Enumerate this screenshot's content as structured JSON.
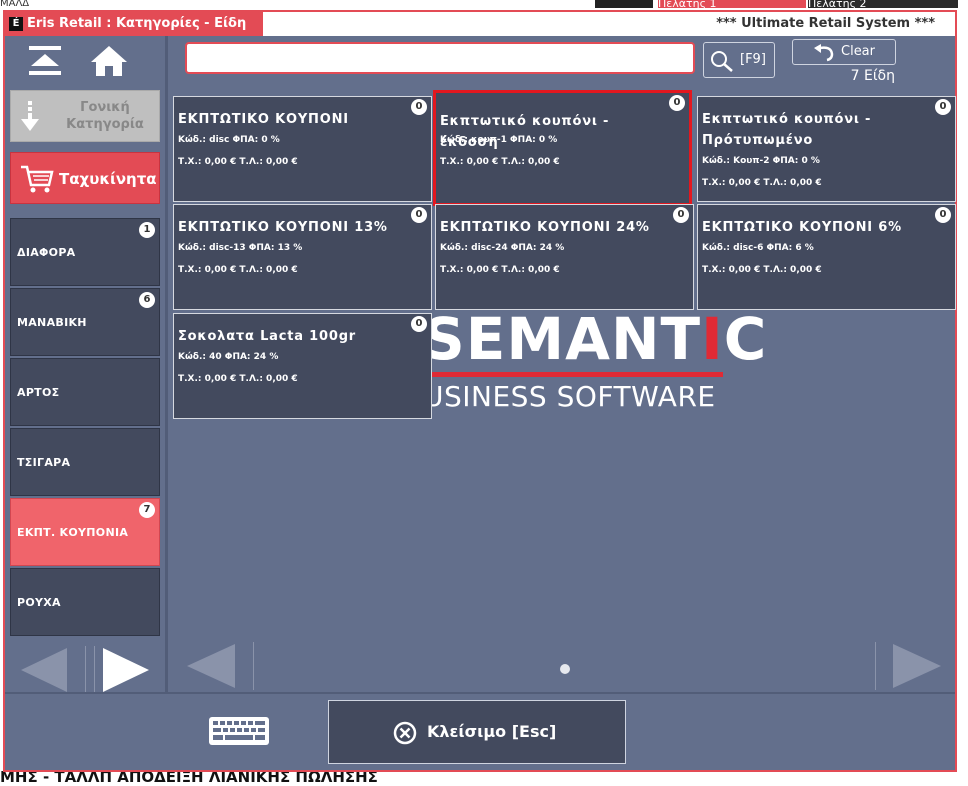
{
  "background": {
    "left_fragment": "ΜΑΛΔ",
    "tab_1": "Πελάτης 1",
    "tab_2": "Πελάτης 2",
    "bottom_text": "ΜΗΣ - ΤΑΛΛΠ ΑΠΟΔΕΙΞΗ ΛΙΑΝΙΚΗΣ ΠΩΛΗΣΗΣ"
  },
  "window": {
    "title": "Eris Retail : Κατηγορίες - Είδη",
    "system_name": "*** Ultimate Retail System ***",
    "app_icon": "É"
  },
  "sidebar": {
    "parent_category_label": "Γονική Κατηγορία",
    "fast_moving_label": "Ταχυκίνητα",
    "categories": [
      {
        "name": "ΔΙΑΦΟΡΑ",
        "count": "1"
      },
      {
        "name": "ΜΑΝΑΒΙΚΗ",
        "count": "6"
      },
      {
        "name": "ΑΡΤΟΣ",
        "count": ""
      },
      {
        "name": "ΤΣΙΓΑΡΑ",
        "count": ""
      },
      {
        "name": "ΕΚΠΤ. ΚΟΥΠΟΝΙΑ",
        "count": "7"
      },
      {
        "name": "ΡΟΥΧΑ",
        "count": ""
      }
    ]
  },
  "search": {
    "value": "",
    "placeholder": "",
    "button_label": "[F9]",
    "clear_label": "Clear",
    "item_count": "7 Είδη"
  },
  "logo": {
    "main_before": "SEMANT",
    "main_red": "I",
    "main_after": "C",
    "subtitle": "USINESS SOFTWARE"
  },
  "products": [
    {
      "name": "ΕΚΠΤΩΤΙΚΟ ΚΟΥΠΟΝΙ",
      "info1": "Κώδ.: disc  ΦΠΑ: 0 %",
      "info2": "Τ.Χ.: 0,00 €  Τ.Λ.: 0,00 €",
      "badge": "0"
    },
    {
      "name": "Εκπτωτικό κουπόνι - έκδοση",
      "info1": "Κώδ.: κουπ-1  ΦΠΑ: 0 %",
      "info2": "Τ.Χ.: 0,00 €  Τ.Λ.: 0,00 €",
      "badge": "0"
    },
    {
      "name": "Εκπτωτικό κουπόνι - Πρότυπωμένο",
      "info1": "Κώδ.: Κουπ-2  ΦΠΑ: 0 %",
      "info2": "Τ.Χ.: 0,00 €  Τ.Λ.: 0,00 €",
      "badge": "0"
    },
    {
      "name": "ΕΚΠΤΩΤΙΚΟ ΚΟΥΠΟΝΙ 13%",
      "info1": "Κώδ.: disc-13  ΦΠΑ: 13 %",
      "info2": "Τ.Χ.: 0,00 €  Τ.Λ.: 0,00 €",
      "badge": "0"
    },
    {
      "name": "ΕΚΠΤΩΤΙΚΟ ΚΟΥΠΟΝΙ 24%",
      "info1": "Κώδ.: disc-24  ΦΠΑ: 24 %",
      "info2": "Τ.Χ.: 0,00 €  Τ.Λ.: 0,00 €",
      "badge": "0"
    },
    {
      "name": "ΕΚΠΤΩΤΙΚΟ ΚΟΥΠΟΝΙ 6%",
      "info1": "Κώδ.: disc-6  ΦΠΑ: 6 %",
      "info2": "Τ.Χ.: 0,00 €  Τ.Λ.: 0,00 €",
      "badge": "0"
    },
    {
      "name": "Σοκολατα Lacta 100gr",
      "info1": "Κώδ.: 40  ΦΠΑ: 24 %",
      "info2": "Τ.Χ.: 0,00 €  Τ.Λ.: 0,00 €",
      "badge": "0"
    }
  ],
  "bottom": {
    "close_label": "Κλείσιμο [Esc]"
  },
  "colors": {
    "accent": "#e34b55",
    "panel": "#636f8c",
    "tile": "#434a5e",
    "selection": "#e3171f"
  }
}
